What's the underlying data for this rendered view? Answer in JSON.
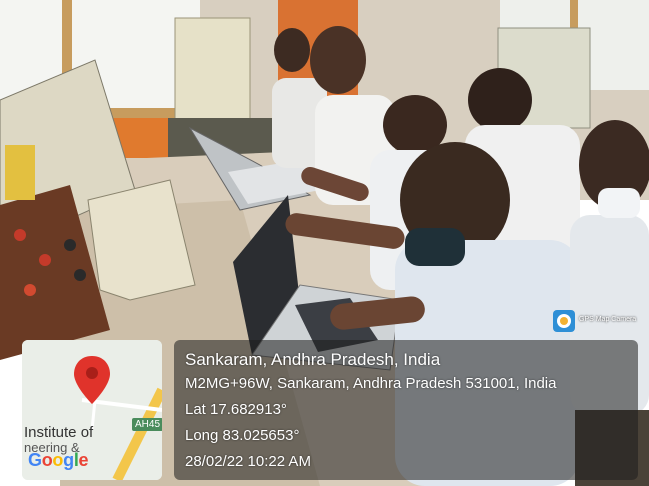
{
  "overlay": {
    "place": "Sankaram, Andhra Pradesh, India",
    "address": "M2MG+96W, Sankaram, Andhra Pradesh 531001, India",
    "lat": "Lat 17.682913°",
    "long": "Long 83.025653°",
    "datetime": "28/02/22 10:22 AM",
    "app_label": "GPS Map Camera"
  },
  "map": {
    "label_institute": "Institute of",
    "label_partial": "neering &",
    "road_code": "AH45",
    "google": "Google",
    "pin_color": "#e0332b"
  },
  "icons": {
    "pin": "map-pin-icon",
    "camera": "gps-camera-icon"
  }
}
